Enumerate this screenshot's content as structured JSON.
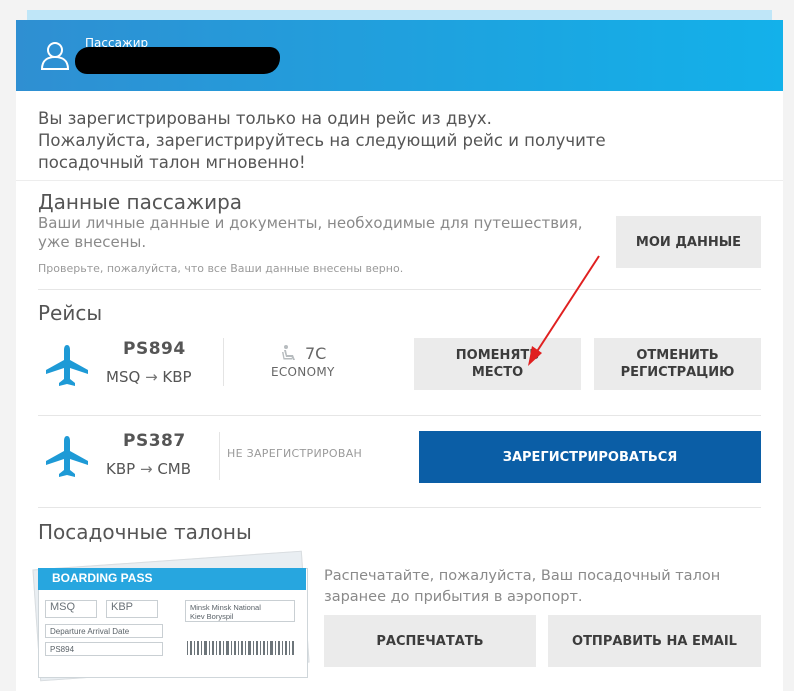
{
  "header": {
    "passenger_label": "Пассажир"
  },
  "notice": {
    "line1": "Вы зарегистрированы только на один рейс из двух.",
    "line2": "Пожалуйста, зарегистрируйтесь на следующий рейс и получите",
    "line3": "посадочный талон мгновенно!"
  },
  "passenger_data": {
    "title": "Данные пассажира",
    "description": "Ваши личные данные и документы, необходимые для путешествия, уже внесены.",
    "note": "Проверьте, пожалуйста, что все Ваши данные внесены верно.",
    "button_label": "МОИ ДАННЫЕ"
  },
  "flights": {
    "title": "Рейсы",
    "items": [
      {
        "flight_no": "PS894",
        "from": "MSQ",
        "to": "KBP",
        "arrow": "→",
        "seat": "7C",
        "class": "ECONOMY",
        "change_seat_line1": "ПОМЕНЯТЬ",
        "change_seat_line2": "МЕСТО",
        "cancel_line1": "ОТМЕНИТЬ",
        "cancel_line2": "РЕГИСТРАЦИЮ"
      },
      {
        "flight_no": "PS387",
        "from": "KBP",
        "to": "CMB",
        "arrow": "→",
        "status": "НЕ ЗАРЕГИСТРИРОВАН",
        "register_label": "ЗАРЕГИСТРИРОВАТЬСЯ"
      }
    ]
  },
  "boarding_passes": {
    "title": "Посадочные талоны",
    "text_line1": "Распечатайте, пожалуйста, Ваш посадочный талон",
    "text_line2": "заранее до прибытия в аэропорт.",
    "print_label": "РАСПЕЧАТАТЬ",
    "email_label": "ОТПРАВИТЬ НА EMAIL",
    "illustration": {
      "title": "BOARDING PASS",
      "from": "MSQ",
      "to": "KBP",
      "cities_line1": "Minsk Minsk National",
      "cities_line2": "Kiev Boryspil",
      "fields": "Departure Arrival Date",
      "flight": "PS894"
    }
  },
  "colors": {
    "header_blue": "#1aa7e2",
    "primary_button": "#0b5ea6",
    "plane_icon": "#1e9ad6",
    "annotation_arrow": "#e02020"
  }
}
